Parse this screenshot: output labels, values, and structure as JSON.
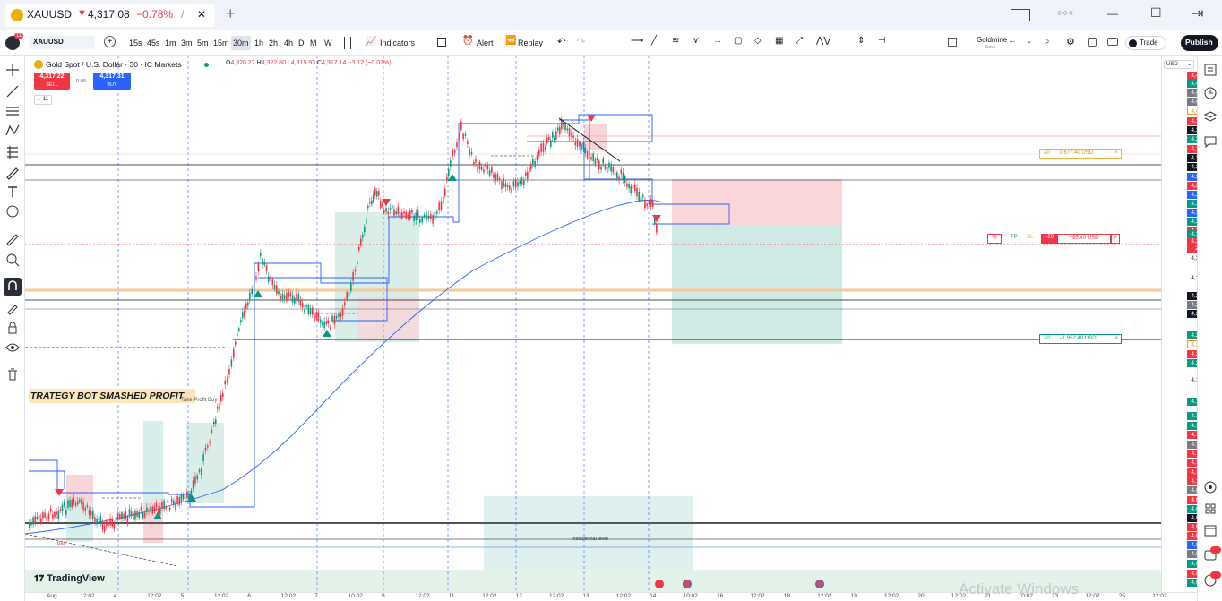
{
  "tab": {
    "symbol": "XAUUSD",
    "price": "4,317.08",
    "change": "−0.78%",
    "sep": "/",
    "close": "✕",
    "new": "+"
  },
  "window": {
    "minimize": "—",
    "maximize": "☐",
    "exit": "⇥",
    "dots": "○○○"
  },
  "toolbar": {
    "symbol": "XAUUSD",
    "badge": "11",
    "intervals": [
      "15s",
      "45s",
      "1m",
      "3m",
      "5m",
      "15m",
      "30m",
      "1h",
      "2h",
      "4h",
      "D",
      "M",
      "W"
    ],
    "active_interval": "30m",
    "indicators": "Indicators",
    "alert": "Alert",
    "replay": "Replay",
    "layout_name": "Goldmine ...",
    "layout_sub": "Save",
    "trade": "Trade",
    "publish": "Publish"
  },
  "legend": {
    "title": "Gold Spot / U.S. Dollar · 30 · IC Markets",
    "ohlc": {
      "o_label": "O",
      "o": "4,320.22",
      "h_label": "H",
      "h": "4,322.80",
      "l_label": "L",
      "l": "4,315.93",
      "c_label": "C",
      "c": "4,317.14",
      "chg": "−3.12 (−0.07%)"
    },
    "sell_price": "4,317.22",
    "sell_label": "SELL",
    "spread": "0.09",
    "buy_price": "4,317.31",
    "buy_label": "BUY",
    "indicator_count": "11"
  },
  "annotations": {
    "banner": "TRATEGY BOT SMASHED PROFIT",
    "take_profit": "Take Profit Buy",
    "institutional": "Institutional level",
    "bar": "bar"
  },
  "positions": {
    "top": {
      "qty": "20",
      "amount": "1,677.40 USD",
      "close": "×"
    },
    "bottom": {
      "qty": "20",
      "amount": "−1,952.40 USD",
      "close": "×"
    },
    "open": {
      "pct": "%",
      "tp": "TP",
      "sl": "SL",
      "qty": "−20",
      "pnl": "+95.40 USD",
      "close": "×"
    }
  },
  "price_axis": {
    "currency": "USD",
    "labels": [
      "4,424.60",
      "4,418.15",
      "4,416.07",
      "4,408.66",
      "4,405.95",
      "4,397.38",
      "4,396.22",
      "4,391.63",
      "4,381.86",
      "4,381.54",
      "4,378.88",
      "4,362.06",
      "4,361.29",
      "4,357.40",
      "4,348.02",
      "4,337.34",
      "4,335.01",
      "4,322.08",
      "4,320.60",
      "4,317.14",
      "27:02",
      "4,300.00",
      "4,280.00",
      "4,262.66",
      "4,262.36",
      "4,253.26",
      "4,224.75",
      "4,224.46",
      "4,222.29",
      "4,220.74",
      "4,180.00",
      "4,159.59",
      "4,144.83",
      "4,142.56",
      "4,135.68",
      "4,117.33",
      "4,112.60",
      "4,104.73",
      "4,102.46",
      "4,101.14",
      "4,099.08",
      "4,098.93",
      "4,095.21",
      "4,094.61",
      "4,091.55",
      "4,089.68",
      "4,088.39",
      "4,080.12",
      "4,079.55",
      "4,072.60",
      "4,071.74"
    ]
  },
  "time_axis": {
    "labels": [
      "Aug",
      "12:02",
      "4",
      "12:02",
      "5",
      "12:02",
      "6",
      "12:02",
      "7",
      "10:02",
      "9",
      "12:02",
      "11",
      "12:02",
      "12",
      "12:02",
      "13",
      "12:02",
      "14",
      "10:02",
      "16",
      "12:02",
      "18",
      "12:02",
      "19",
      "12:02",
      "20",
      "12:02",
      "21",
      "10:02",
      "23",
      "12:02",
      "25",
      "12:02"
    ]
  },
  "watermark": "Activate Windows",
  "brand": "TradingView",
  "colors": {
    "up": "#089981",
    "down": "#f23645",
    "accent": "#2962ff",
    "ema": "#2962ff",
    "tp_zone": "#d1ece7",
    "sl_zone": "#fbd7da"
  }
}
